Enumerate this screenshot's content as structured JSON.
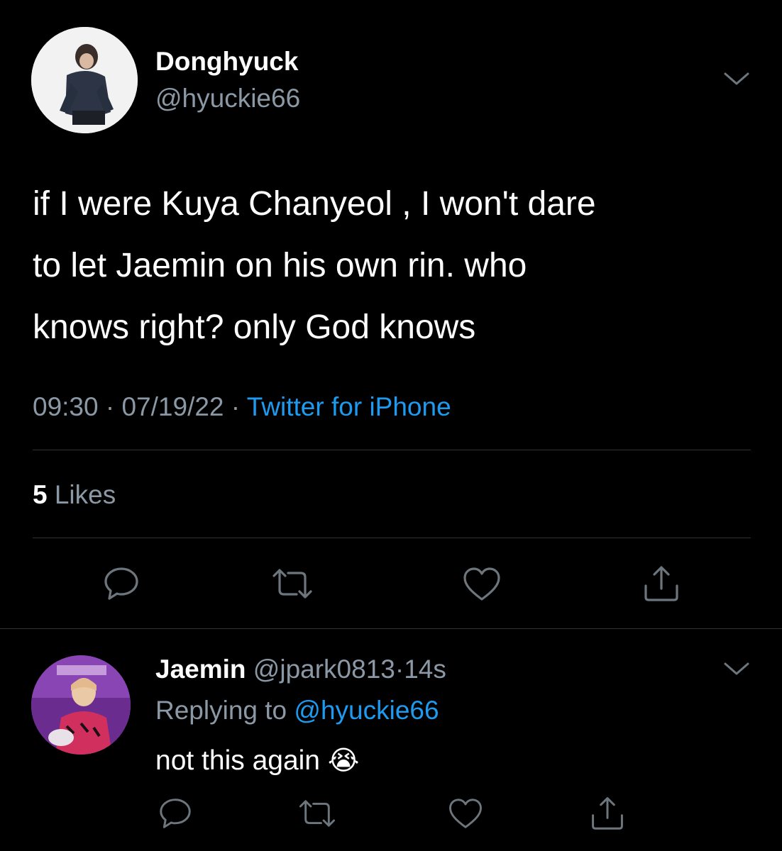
{
  "tweet": {
    "author_name": "Donghyuck",
    "author_handle": "@hyuckie66",
    "text_lines": [
      "if I were Kuya Chanyeol , I won't dare",
      "to let Jaemin on his own rin. who",
      "knows right? only God knows"
    ],
    "time": "09:30",
    "date": "07/19/22",
    "sep": "·",
    "source": "Twitter for iPhone",
    "likes_count": "5",
    "likes_label": "Likes"
  },
  "reply": {
    "author_name": "Jaemin",
    "author_handle": "@jpark0813",
    "sep": "·",
    "age": "14s",
    "replying_prefix": "Replying to",
    "replying_handle": "@hyuckie66",
    "text": "not this again",
    "emoji": "😭"
  },
  "icons": {
    "reply": "reply-icon",
    "retweet": "retweet-icon",
    "like": "heart-icon",
    "share": "share-icon",
    "menu": "chevron-down-icon"
  },
  "colors": {
    "background": "#000000",
    "text": "#ffffff",
    "muted": "#8b98a5",
    "link": "#1d9bf0",
    "divider": "#2f3336"
  }
}
